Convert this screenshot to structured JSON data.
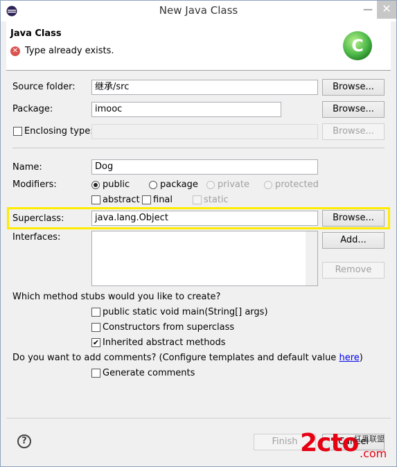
{
  "window": {
    "title": "New Java Class",
    "minimize": "—",
    "close": "✕"
  },
  "header": {
    "title": "Java Class",
    "error_message": "Type already exists.",
    "logo_letter": "C"
  },
  "source_folder": {
    "label": "Source folder:",
    "value": "继承/src",
    "browse": "Browse..."
  },
  "package": {
    "label": "Package:",
    "value": "imooc",
    "browse": "Browse..."
  },
  "enclosing": {
    "label": "Enclosing type:",
    "value": "",
    "browse": "Browse...",
    "checked": false
  },
  "name": {
    "label": "Name:",
    "value": "Dog"
  },
  "modifiers": {
    "label": "Modifiers:",
    "public": "public",
    "package": "package",
    "private": "private",
    "protected": "protected",
    "abstract": "abstract",
    "final": "final",
    "static": "static",
    "selected": "public"
  },
  "superclass": {
    "label": "Superclass:",
    "value": "java.lang.Object",
    "browse": "Browse..."
  },
  "interfaces": {
    "label": "Interfaces:",
    "add": "Add...",
    "remove": "Remove"
  },
  "stubs": {
    "question": "Which method stubs would you like to create?",
    "main": "public static void main(String[] args)",
    "constructors": "Constructors from superclass",
    "inherited": "Inherited abstract methods",
    "main_checked": false,
    "constructors_checked": false,
    "inherited_checked": true
  },
  "comments": {
    "question_prefix": "Do you want to add comments? (Configure templates and default value ",
    "link": "here",
    "question_suffix": ")",
    "generate": "Generate comments",
    "generate_checked": false
  },
  "footer": {
    "help": "?",
    "finish": "Finish",
    "cancel": "Cancel"
  },
  "watermark": {
    "text": "2cto",
    "domain": ".com",
    "cn": "红黑联盟"
  },
  "colors": {
    "highlight": "#ffec00",
    "error": "#d9534f",
    "logo_green": "#4cb848"
  }
}
